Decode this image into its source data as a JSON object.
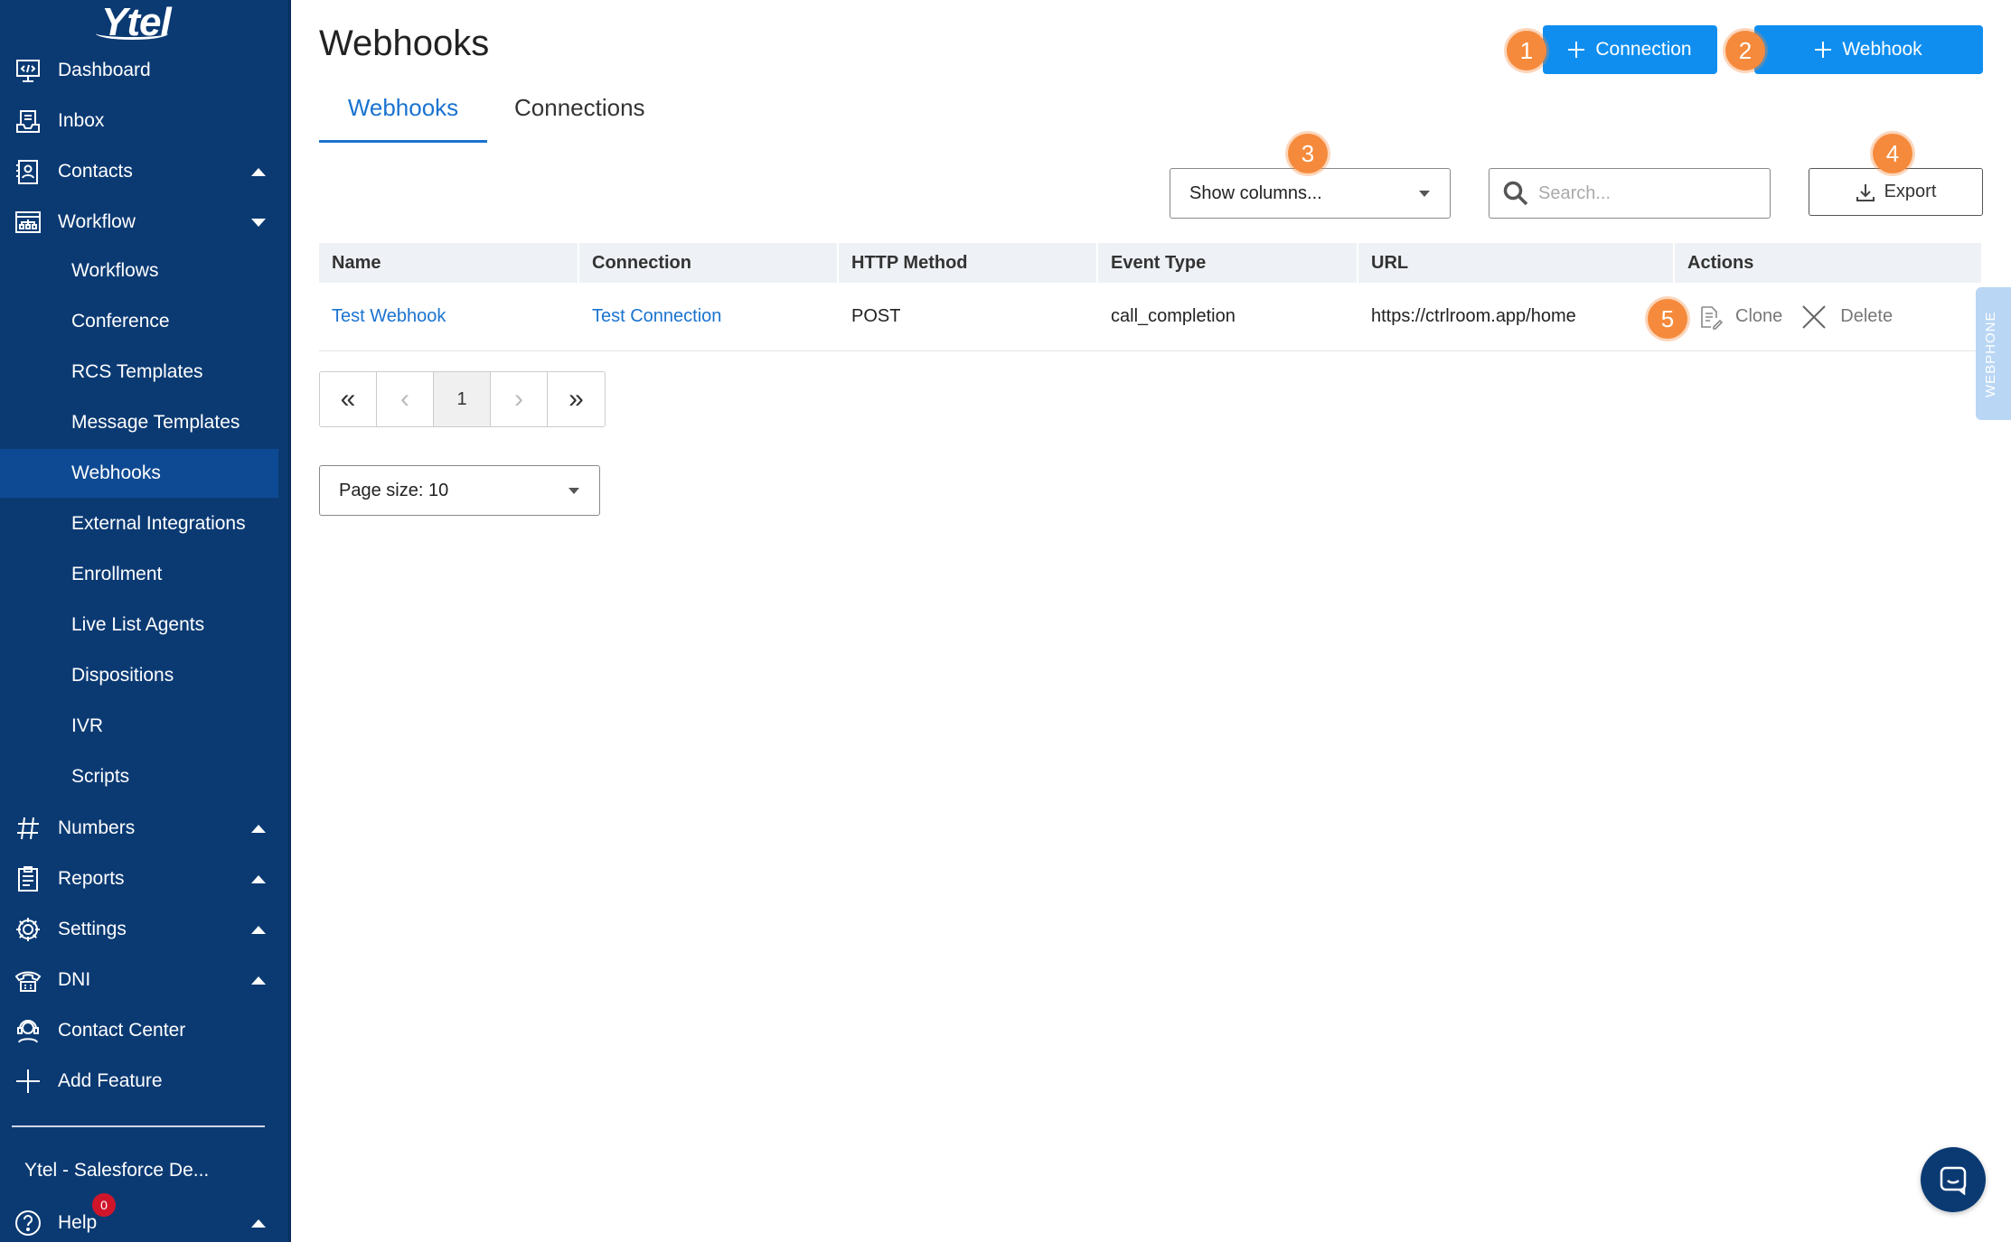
{
  "app": {
    "logo_text": "Ytel"
  },
  "sidebar": {
    "items": [
      {
        "label": "Dashboard",
        "icon": "dashboard-icon"
      },
      {
        "label": "Inbox",
        "icon": "inbox-icon"
      },
      {
        "label": "Contacts",
        "icon": "contacts-icon",
        "expanded": false
      },
      {
        "label": "Workflow",
        "icon": "workflow-icon",
        "expanded": true
      }
    ],
    "workflow_subitems": [
      "Workflows",
      "Conference",
      "RCS Templates",
      "Message Templates",
      "Webhooks",
      "External Integrations",
      "Enrollment",
      "Live List Agents",
      "Dispositions",
      "IVR",
      "Scripts"
    ],
    "active_subitem": "Webhooks",
    "lower_items": [
      {
        "label": "Numbers",
        "icon": "hash-icon",
        "caret": true
      },
      {
        "label": "Reports",
        "icon": "reports-icon",
        "caret": true
      },
      {
        "label": "Settings",
        "icon": "gear-icon",
        "caret": true
      },
      {
        "label": "DNI",
        "icon": "phone-icon",
        "caret": true
      },
      {
        "label": "Contact Center",
        "icon": "headset-icon",
        "caret": false
      },
      {
        "label": "Add Feature",
        "icon": "plus-icon",
        "caret": false
      }
    ],
    "org_name": "Ytel - Salesforce De...",
    "help_label": "Help",
    "help_badge": "0"
  },
  "header": {
    "title": "Webhooks",
    "tabs": [
      {
        "label": "Webhooks",
        "active": true
      },
      {
        "label": "Connections",
        "active": false
      }
    ],
    "add_connection_label": "Connection",
    "add_webhook_label": "Webhook"
  },
  "markers": [
    "1",
    "2",
    "3",
    "4",
    "5"
  ],
  "toolbar": {
    "show_columns_label": "Show columns...",
    "search_placeholder": "Search...",
    "export_label": "Export"
  },
  "table": {
    "columns": [
      "Name",
      "Connection",
      "HTTP Method",
      "Event Type",
      "URL",
      "Actions"
    ],
    "rows": [
      {
        "name": "Test Webhook",
        "connection": "Test Connection",
        "method": "POST",
        "event_type": "call_completion",
        "url": "https://ctrlroom.app/home",
        "actions": [
          "Clone",
          "Delete"
        ]
      }
    ]
  },
  "pagination": {
    "first": "«",
    "prev": "‹",
    "current_page": "1",
    "next": "›",
    "last": "»",
    "page_size_label": "Page size: 10"
  },
  "webphone_label": "WEBPHONE",
  "colors": {
    "sidebar_bg": "#0b3a73",
    "active_item_bg": "#0e4a93",
    "primary_button": "#0f8ef0",
    "link": "#1a73d0",
    "marker": "#f58a3c"
  }
}
